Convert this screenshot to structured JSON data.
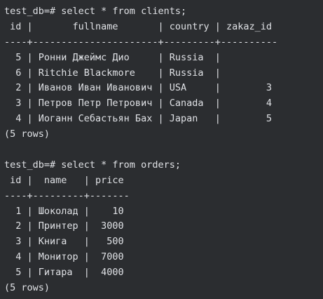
{
  "colors": {
    "background": "#2b2d30",
    "text": "#dfe1e5"
  },
  "query1": {
    "command": "test_db=# select * from clients;",
    "header": " id |       fullname       | country | zakaz_id",
    "separator": "----+----------------------+---------+----------",
    "rows": [
      "  5 | Ронни Джеймс Дио     | Russia  |",
      "  6 | Ritchie Blackmore    | Russia  |",
      "  2 | Иванов Иван Иванович | USA     |        3",
      "  3 | Петров Петр Петрович | Canada  |        4",
      "  4 | Иоганн Себастьян Бах | Japan   |        5"
    ],
    "footer": "(5 rows)"
  },
  "query2": {
    "command": "test_db=# select * from orders;",
    "header": " id |  name   | price",
    "separator": "----+---------+-------",
    "rows": [
      "  1 | Шоколад |    10",
      "  2 | Принтер |  3000",
      "  3 | Книга   |   500",
      "  4 | Монитор |  7000",
      "  5 | Гитара  |  4000"
    ],
    "footer": "(5 rows)"
  }
}
